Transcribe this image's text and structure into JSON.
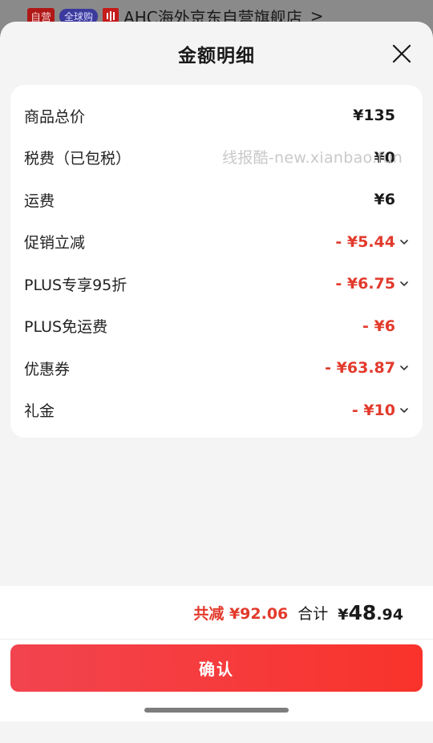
{
  "store_bar": {
    "tag_self": "自营",
    "tag_global": "全球购",
    "store_name": "AHC海外京东自营旗舰店",
    "chevron": ">"
  },
  "sheet": {
    "title": "金额明细",
    "close_icon": "close-icon"
  },
  "rows": [
    {
      "label": "商品总价",
      "value": "¥135",
      "discount": false,
      "expandable": false
    },
    {
      "label": "税费（已包税）",
      "value": "¥0",
      "discount": false,
      "expandable": false
    },
    {
      "label": "运费",
      "value": "¥6",
      "discount": false,
      "expandable": false
    },
    {
      "label": "促销立减",
      "value": "- ¥5.44",
      "discount": true,
      "expandable": true
    },
    {
      "label": "PLUS专享95折",
      "value": "- ¥6.75",
      "discount": true,
      "expandable": true
    },
    {
      "label": "PLUS免运费",
      "value": "- ¥6",
      "discount": true,
      "expandable": false
    },
    {
      "label": "优惠券",
      "value": "- ¥63.87",
      "discount": true,
      "expandable": true
    },
    {
      "label": "礼金",
      "value": "- ¥10",
      "discount": true,
      "expandable": true
    }
  ],
  "watermark": "线报酷-new.xianbao.fun",
  "summary": {
    "discount_text": "共减 ¥92.06",
    "total_label": "合计",
    "total_symbol": "¥",
    "total_integer": "48",
    "total_decimal": ".94"
  },
  "confirm_label": "确认",
  "colors": {
    "discount": "#e23a2c",
    "button_start": "#f2444f",
    "button_end": "#f9332b"
  }
}
